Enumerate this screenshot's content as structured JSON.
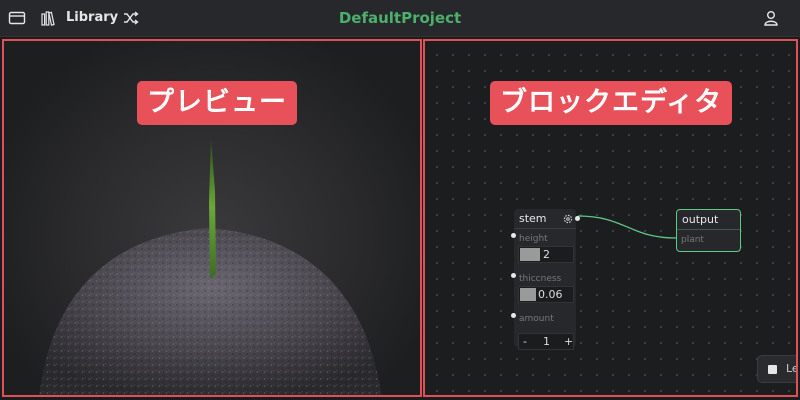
{
  "topbar": {
    "folder_icon": "folder-icon",
    "library_icon": "library-icon",
    "library_label": "Library",
    "shuffle_icon": "shuffle-icon",
    "project_title": "DefaultProject",
    "user_icon": "user-icon"
  },
  "preview": {
    "annotation": "プレビュー"
  },
  "editor": {
    "annotation": "ブロックエディタ",
    "stem_node": {
      "title": "stem",
      "settings_icon": "gear-icon",
      "height_label": "height",
      "height_value": "2",
      "thickness_label": "thiccness",
      "thickness_value": "0.06",
      "amount_label": "amount",
      "amount_minus": "-",
      "amount_value": "1",
      "amount_plus": "+"
    },
    "output_node": {
      "title": "output",
      "input_label": "plant"
    },
    "corner_toggle_label": "Le"
  },
  "colors": {
    "accent_green": "#4caf6c",
    "annotation_red": "#e8505a",
    "connection": "#5ec98a"
  }
}
